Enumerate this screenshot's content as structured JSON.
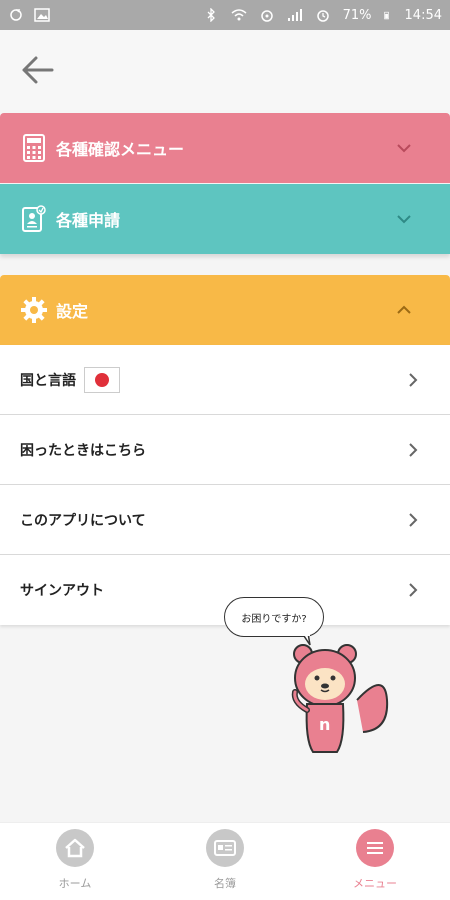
{
  "status_bar": {
    "battery": "71%",
    "time": "14:54"
  },
  "sections": {
    "confirm_menu": {
      "label": "各種確認メニュー",
      "color": "#e98090"
    },
    "applications": {
      "label": "各種申請",
      "color": "#5ec5c0"
    },
    "settings": {
      "label": "設定",
      "color": "#f8b947"
    }
  },
  "settings_items": [
    {
      "label": "国と言語"
    },
    {
      "label": "困ったときはこちら"
    },
    {
      "label": "このアプリについて"
    },
    {
      "label": "サインアウト"
    }
  ],
  "mascot": {
    "speech": "お困りですか?"
  },
  "bottom_nav": [
    {
      "label": "ホーム",
      "icon": "home-icon"
    },
    {
      "label": "名簿",
      "icon": "roster-icon"
    },
    {
      "label": "メニュー",
      "icon": "menu-icon"
    }
  ]
}
